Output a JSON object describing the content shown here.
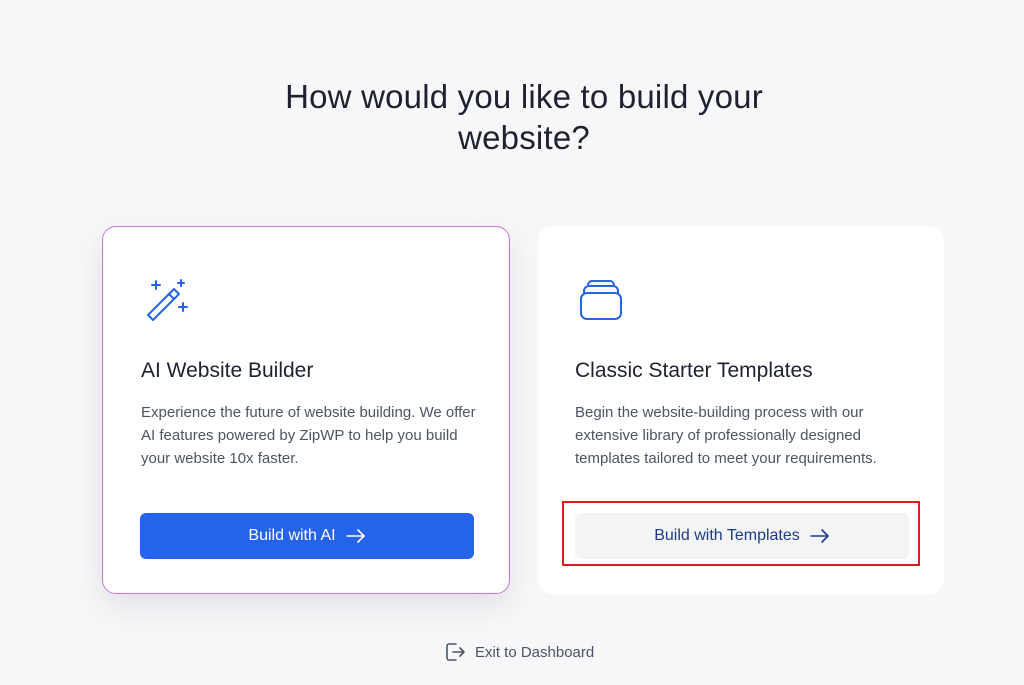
{
  "page": {
    "heading": "How would you like to build your website?"
  },
  "cards": {
    "ai": {
      "icon": "magic-wand-icon",
      "title": "AI Website Builder",
      "description": "Experience the future of website building. We offer AI features powered by ZipWP to help you build your website 10x faster.",
      "button_label": "Build with AI"
    },
    "classic": {
      "icon": "templates-stack-icon",
      "title": "Classic Starter Templates",
      "description": "Begin the website-building process with our extensive library of professionally designed templates tailored to meet your requirements.",
      "button_label": "Build with Templates"
    }
  },
  "footer": {
    "exit_icon": "exit-icon",
    "exit_label": "Exit to Dashboard"
  },
  "colors": {
    "primary": "#2563eb",
    "highlight": "#dd1c1c",
    "card_border_ai": "#c77adf",
    "heading": "#1e2230"
  }
}
